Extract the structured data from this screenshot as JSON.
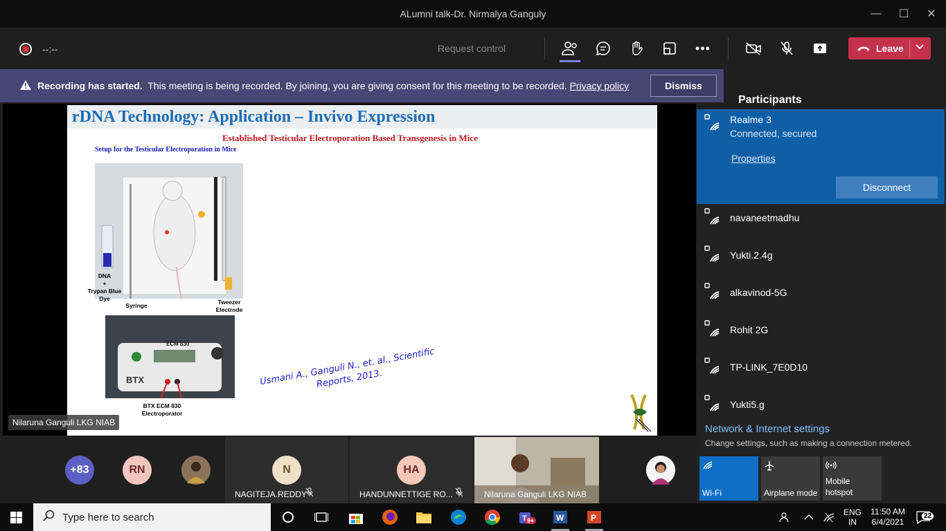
{
  "window": {
    "title": "ALumni talk-Dr. Nirmalya Ganguly",
    "minimize_glyph": "—",
    "maximize_glyph": "☐",
    "close_glyph": "✕"
  },
  "toolbar": {
    "timer": "--:--",
    "request_control": "Request control",
    "leave_label": "Leave",
    "icons": [
      "participants-icon",
      "chat-icon",
      "raise-hand-icon",
      "breakout-icon",
      "more-options-icon",
      "camera-off-icon",
      "mic-off-icon",
      "share-icon"
    ]
  },
  "banner": {
    "bold": "Recording has started.",
    "text": "This meeting is being recorded. By joining, you are giving consent for this meeting to be recorded.",
    "link": "Privacy policy",
    "dismiss": "Dismiss",
    "panel_title": "Participants"
  },
  "slide": {
    "title": "rDNA Technology: Application – Invivo Expression",
    "subtitle": "Established Testicular Electroporation Based Transgenesis in Mice",
    "setup": "Setup for the Testicular Electroporation in Mice",
    "label_dna": "DNA\n+\nTrypan Blue\nDye",
    "label_syringe": "Syringe",
    "label_tweezer": "Tweezer\nElectrode",
    "device_brand": "BTX",
    "device_model": "ECM 830",
    "label_device": "BTX ECM 830\nElectroporator",
    "citation": "Usmani A., Ganguli N., et. al., Scientific Reports, 2013."
  },
  "presenter_tag": "Nilaruna Ganguli LKG NIAB",
  "participants": {
    "overflow": "+83",
    "rn": "RN",
    "tile1_initial": "N",
    "tile1_name": "NAGITEJA.REDDY",
    "tile2_initial": "HA",
    "tile2_name": "HANDUNNETTIGE RO...",
    "tile3_name": "Nilaruna Ganguli LKG NIAB",
    "mic_glyph": "🎙"
  },
  "wifi": {
    "active": {
      "name": "Realme 3",
      "status": "Connected, secured",
      "properties": "Properties",
      "disconnect": "Disconnect"
    },
    "networks": [
      "navaneetmadhu",
      "Yukti.2.4g",
      "alkavinod-5G",
      "Rohit 2G",
      "TP-LINK_7E0D10",
      "Yukti5.g"
    ],
    "settings_title": "Network & Internet settings",
    "settings_desc": "Change settings, such as making a connection metered.",
    "quick": [
      {
        "label": "Wi-Fi",
        "icon": "wifi-icon",
        "active": true
      },
      {
        "label": "Airplane mode",
        "icon": "airplane-icon",
        "active": false
      },
      {
        "label": "Mobile\nhotspot",
        "icon": "hotspot-icon",
        "active": false
      }
    ]
  },
  "taskbar": {
    "search_placeholder": "Type here to search",
    "apps": [
      "task-view-icon",
      "store-icon",
      "firefox-icon",
      "file-explorer-icon",
      "edge-icon",
      "chrome-icon",
      "teams-icon",
      "word-icon",
      "powerpoint-icon"
    ],
    "teams_badge": "9+",
    "lang": "ENG",
    "region": "IN",
    "time": "11:50 AM",
    "date": "6/4/2021",
    "notifications": "22"
  },
  "colors": {
    "leave": "#c4314b",
    "banner": "#464775",
    "wifi_active": "#0e5fa6",
    "slide_title": "#1b6db5",
    "slide_subtitle": "#c0181c"
  }
}
